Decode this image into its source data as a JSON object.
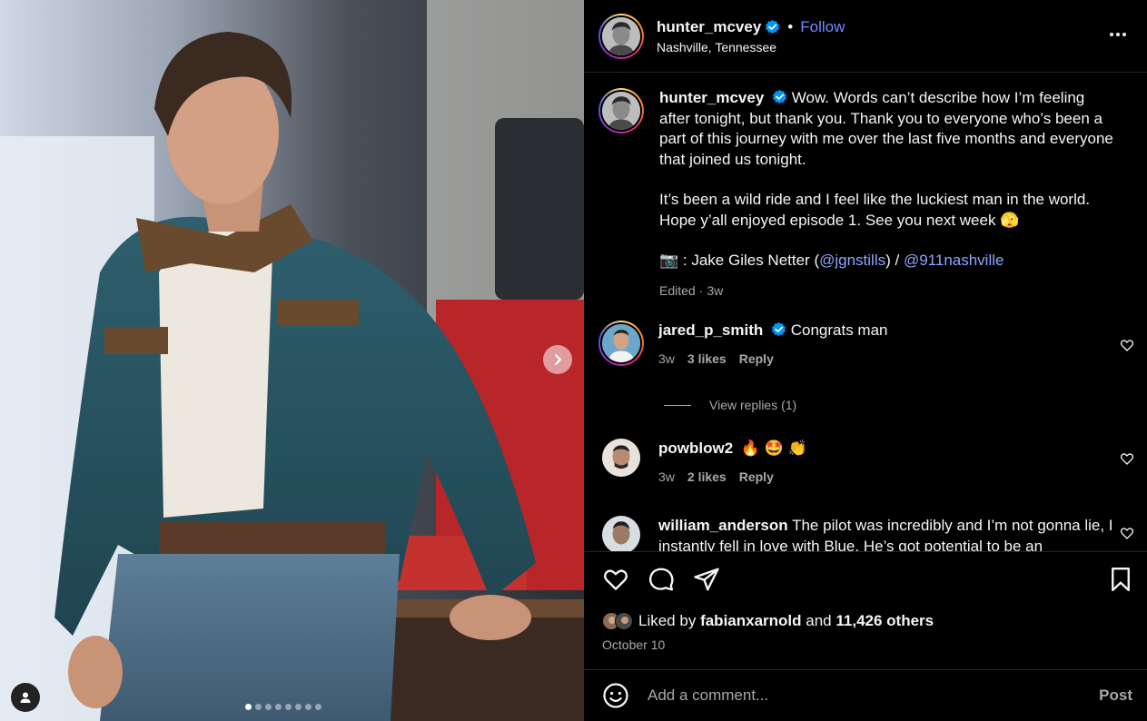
{
  "header": {
    "username": "hunter_mcvey",
    "follow_label": "Follow",
    "separator": "•",
    "location": "Nashville, Tennessee",
    "more_icon": "more-horizontal-icon"
  },
  "caption": {
    "username": "hunter_mcvey",
    "paragraph1": "Wow. Words can’t describe how I’m feeling after tonight, but thank you. Thank you to everyone who’s been a part of this journey with me over the last five months and everyone that joined us tonight.",
    "paragraph2": "It’s been a wild ride and I feel like the luckiest man in the world. Hope y’all enjoyed episode 1. See you next week 🫣",
    "credit_prefix": "📷 : Jake Giles Netter (",
    "mention1": "@jgnstills",
    "credit_mid": ") / ",
    "mention2": "@911nashville",
    "edited": "Edited",
    "meta_sep": "·",
    "time": "3w"
  },
  "comments": [
    {
      "username": "jared_p_smith",
      "verified": true,
      "text": "Congrats man",
      "time": "3w",
      "likes": "3 likes",
      "reply": "Reply"
    },
    {
      "username": "powblow2",
      "verified": false,
      "text": "🔥 🤩 👏",
      "time": "3w",
      "likes": "2 likes",
      "reply": "Reply"
    },
    {
      "username": "william_anderson",
      "verified": false,
      "text": "The pilot was incredibly and I’m not gonna lie, I instantly fell in love with Blue. He’s got potential to be an"
    }
  ],
  "view_replies": "View replies (1)",
  "likes": {
    "prefix": "Liked by",
    "user": "fabianxarnold",
    "conj": "and",
    "others": "11,426 others"
  },
  "date": "October 10",
  "composer": {
    "placeholder": "Add a comment...",
    "post_label": "Post"
  },
  "carousel": {
    "slides": 8,
    "active_index": 0
  },
  "colors": {
    "accent": "#0095f6",
    "link": "#8ea5ff",
    "follow": "#6f8cff",
    "muted": "#a8a8a8",
    "background": "#000000"
  }
}
